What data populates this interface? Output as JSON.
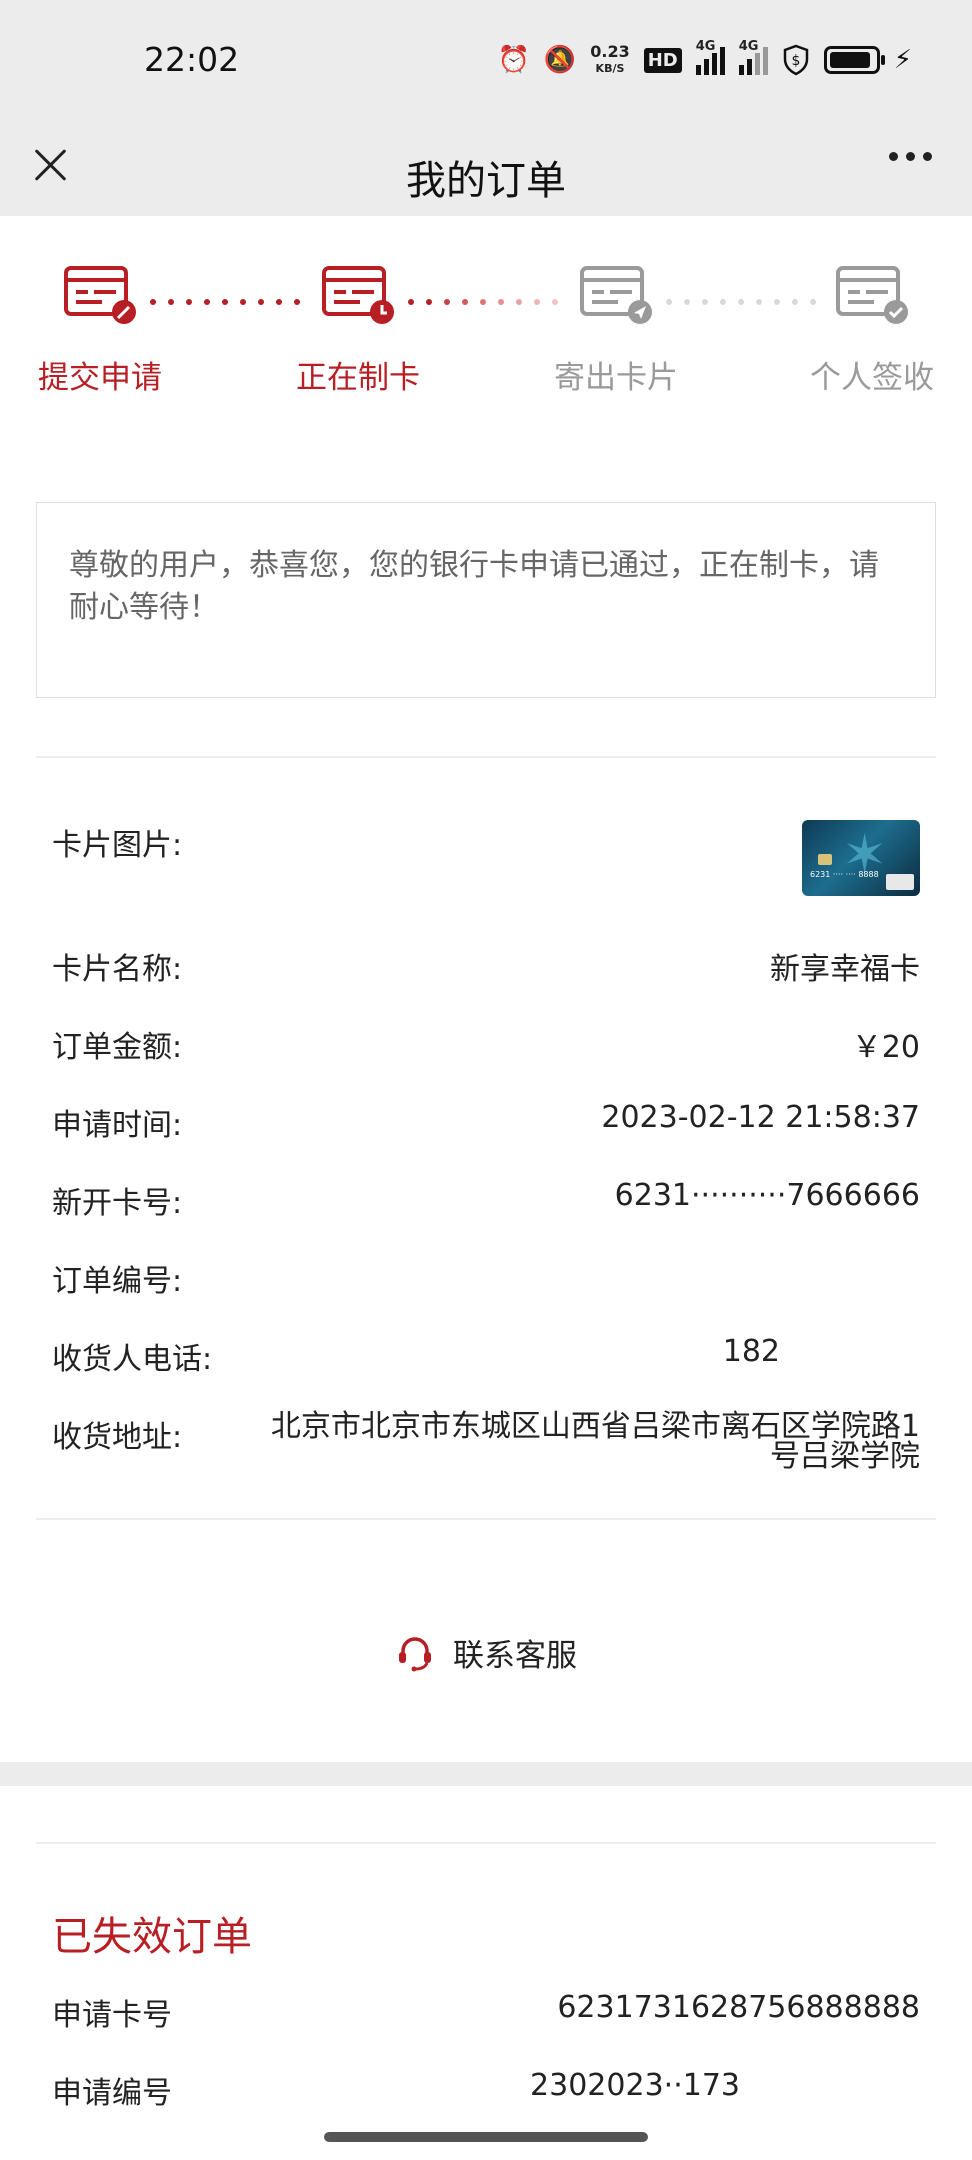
{
  "status_bar": {
    "time": "22:02",
    "speed": "0.23",
    "speed_unit": "KB/S",
    "hd": "HD",
    "net1": "4G",
    "net2": "4G"
  },
  "nav": {
    "title": "我的订单"
  },
  "steps": [
    {
      "label": "提交申请",
      "state": "done",
      "icon": "application-pen-icon"
    },
    {
      "label": "正在制卡",
      "state": "current",
      "icon": "application-clock-icon"
    },
    {
      "label": "寄出卡片",
      "state": "pending",
      "icon": "application-send-icon"
    },
    {
      "label": "个人签收",
      "state": "pending",
      "icon": "application-check-icon"
    }
  ],
  "notice": {
    "text": "尊敬的用户，恭喜您，您的银行卡申请已通过，正在制卡，请耐心等待！"
  },
  "order": {
    "card_image_label": "卡片图片:",
    "card_name_label": "卡片名称:",
    "card_name": "新享幸福卡",
    "amount_label": "订单金额:",
    "amount": "￥20",
    "apply_time_label": "申请时间:",
    "apply_time": "2023-02-12 21:58:37",
    "card_number_label": "新开卡号:",
    "card_number": "6231··········7666666",
    "order_no_label": "订单编号:",
    "order_no": "",
    "phone_label": "收货人电话:",
    "phone": "182",
    "address_label": "收货地址:",
    "address_line1": "北京市北京市东城区山西省吕梁市离石区学院路1",
    "address_line2": "号吕梁学院"
  },
  "service": {
    "label": "联系客服"
  },
  "expired": {
    "title": "已失效订单",
    "card_number_label": "申请卡号",
    "card_number": "6231731628756888888",
    "apply_no_label": "申请编号",
    "apply_no": "2302023··173"
  },
  "colors": {
    "accent": "#b71f24",
    "inactive": "#9a9a9a",
    "background_gray": "#ececec"
  }
}
